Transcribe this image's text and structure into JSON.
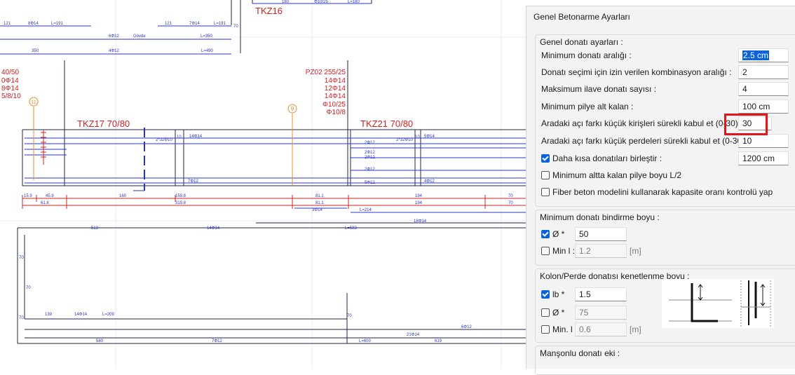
{
  "drawing": {
    "labels": {
      "tkz16": "TKZ16",
      "tkz17": "TKZ17 70/80",
      "tkz21": "TKZ21 70/80",
      "axis11": "11",
      "axis9": "9",
      "pz02_1": "PZ02 255/25",
      "pz02_2": "14Φ14",
      "pz02_3": "12Φ14",
      "pz02_4": "14Φ14",
      "pz02_5": "Φ10/25",
      "pz02_6": "Φ10/8",
      "left_1": "40/50",
      "left_2": "0Φ14",
      "left_3": "8Φ14",
      "left_4": "5/8/10"
    },
    "bar_texts": [
      "121",
      "8Φ14",
      "L=191",
      "121",
      "7Φ14",
      "L=191",
      "70",
      "160",
      "Φ10/25",
      "L=180",
      "6Φ12",
      "Gövde",
      "L=350",
      "350",
      "4Φ12",
      "L=490",
      "2*32Φ10",
      "10",
      "14Φ14",
      "2*32Φ10",
      "10",
      "5Φ14",
      "2Φ12",
      "2Φ12",
      "2Φ12",
      "2Φ12",
      "7Φ12",
      "4Φ12",
      "5Φ12",
      "15.9",
      "45.9",
      "160",
      "159.8",
      "81.1",
      "194",
      "70",
      "61.8",
      "319.8",
      "81.1",
      "194",
      "70",
      "3Φ14",
      "L=214",
      "18Φ14",
      "513",
      "14Φ14",
      "L=583",
      "70",
      "70",
      "70",
      "139",
      "14Φ14",
      "L=209",
      "70",
      "6Φ12",
      "21Φ14",
      "580",
      "7Φ12",
      "L=600",
      "619"
    ]
  },
  "panel": {
    "title": "Genel Betonarme Ayarları",
    "general": {
      "title": "Genel donatı ayarları :",
      "min_spacing_label": "Minimum donatı aralığı :",
      "min_spacing_value": "2.5 cm",
      "combo_range_label": "Donatı seçimi için izin verilen kombinasyon aralığı :",
      "combo_range_value": "2",
      "max_extra_label": "Maksimum ilave donatı sayısı :",
      "max_extra_value": "4",
      "min_pile_label": "Minimum pilye alt kalan :",
      "min_pile_value": "100 cm",
      "beam_angle_label": "Aradaki açı farkı küçük kirişleri sürekli kabul et (0-30) :",
      "beam_angle_value": "30",
      "wall_angle_label": "Aradaki açı farkı küçük perdeleri sürekli kabul et (0-30) :",
      "wall_angle_value": "10",
      "merge_short_label": "Daha kısa donatıları birleştir :",
      "merge_short_value": "1200 cm",
      "merge_short_checked": true,
      "min_bottom_pile_label": "Minimum altta kalan pilye boyu L/2",
      "min_bottom_pile_checked": false,
      "fiber_label": "Fiber beton modelini kullanarak kapasite oranı kontrolü yap",
      "fiber_checked": false
    },
    "overlap": {
      "title": "Minimum donatı bindirme boyu :",
      "dia_label": "Ø *",
      "dia_value": "50",
      "dia_checked": true,
      "minl_label": "Min l :",
      "minl_value": "1.2",
      "minl_checked": false,
      "minl_unit": "[m]"
    },
    "anchorage": {
      "title": "Kolon/Perde donatısı kenetlenme boyu :",
      "lb_label": "lb *",
      "lb_value": "1.5",
      "lb_checked": true,
      "dia_label": "Ø *",
      "dia_value": "75",
      "dia_checked": false,
      "minl_label": "Min. l :",
      "minl_value": "0.6",
      "minl_checked": false,
      "minl_unit": "[m]"
    },
    "coupler": {
      "title": "Manşonlu donatı eki :"
    }
  },
  "colors": {
    "cad_blue": "#2a35c8",
    "cad_red": "#d42020",
    "cad_orange": "#e8902a",
    "cad_dark": "#23234a",
    "accent": "#0a64d8",
    "highlight": "#e4141b"
  }
}
